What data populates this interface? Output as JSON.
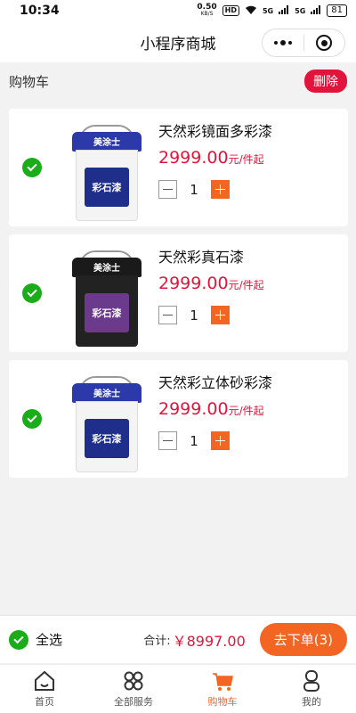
{
  "status": {
    "time": "10:34",
    "net_speed": "0.50",
    "net_unit": "KB/S",
    "hd": "HD",
    "signal_1": "5G",
    "signal_2": "5G",
    "battery": "81"
  },
  "nav": {
    "title": "小程序商城"
  },
  "cart": {
    "title": "购物车",
    "delete_label": "删除"
  },
  "products": [
    {
      "name": "天然彩镜面多彩漆",
      "price": "2999.00",
      "unit": "元/件起",
      "qty": "1",
      "brand": "美涂士",
      "label": "彩石漆",
      "lid_color": "#2b3aa8",
      "body_color": "#f4f4f4",
      "label_color": "#1e2e8a"
    },
    {
      "name": "天然彩真石漆",
      "price": "2999.00",
      "unit": "元/件起",
      "qty": "1",
      "brand": "美涂士",
      "label": "彩石漆",
      "lid_color": "#1a1a1a",
      "body_color": "#222222",
      "label_color": "#6b3a8c"
    },
    {
      "name": "天然彩立体砂彩漆",
      "price": "2999.00",
      "unit": "元/件起",
      "qty": "1",
      "brand": "美涂士",
      "label": "彩石漆",
      "lid_color": "#2b3aa8",
      "body_color": "#f4f4f4",
      "label_color": "#1e2e8a"
    }
  ],
  "footer": {
    "select_all": "全选",
    "total_label": "合计:",
    "total_value": "￥8997.00",
    "order_label": "去下单(3)"
  },
  "tabs": [
    {
      "label": "首页",
      "icon": "home-icon"
    },
    {
      "label": "全部服务",
      "icon": "grid-icon"
    },
    {
      "label": "购物车",
      "icon": "cart-icon"
    },
    {
      "label": "我的",
      "icon": "user-icon"
    }
  ],
  "colors": {
    "accent": "#f26522",
    "price": "#e1143c",
    "check": "#1aad19"
  }
}
